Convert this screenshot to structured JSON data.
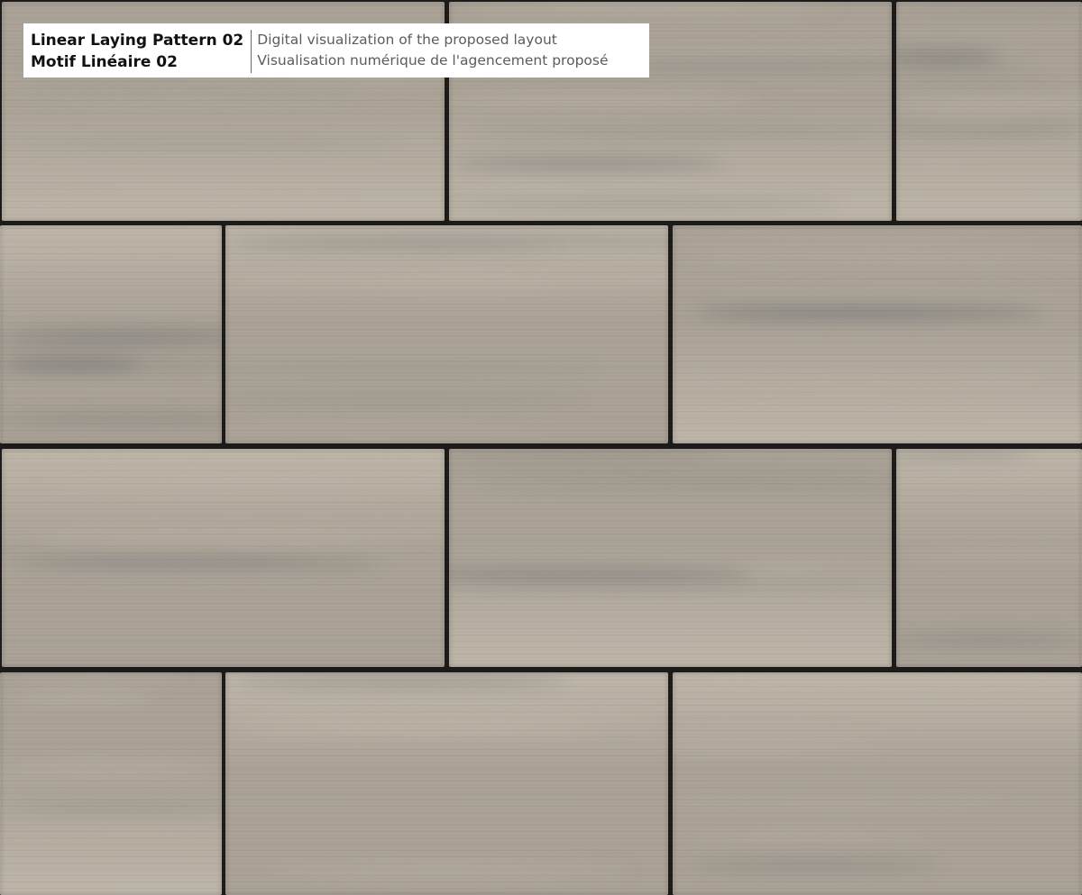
{
  "label": {
    "title_en": "Linear Laying Pattern 02",
    "title_fr": "Motif Linéaire 02",
    "subtitle_en": "Digital visualization of the proposed layout",
    "subtitle_fr": "Visualisation numérique de l'agencement proposé"
  },
  "colors": {
    "joint": "#1c1b1a",
    "stone_base": "#a9a195",
    "stone_light": "#bdb5a8",
    "stone_grey": "#7d7c7b"
  },
  "pattern": {
    "name": "running-bond",
    "rows": 4,
    "offset_fraction": 0.5,
    "paver_aspect": "2:1"
  }
}
